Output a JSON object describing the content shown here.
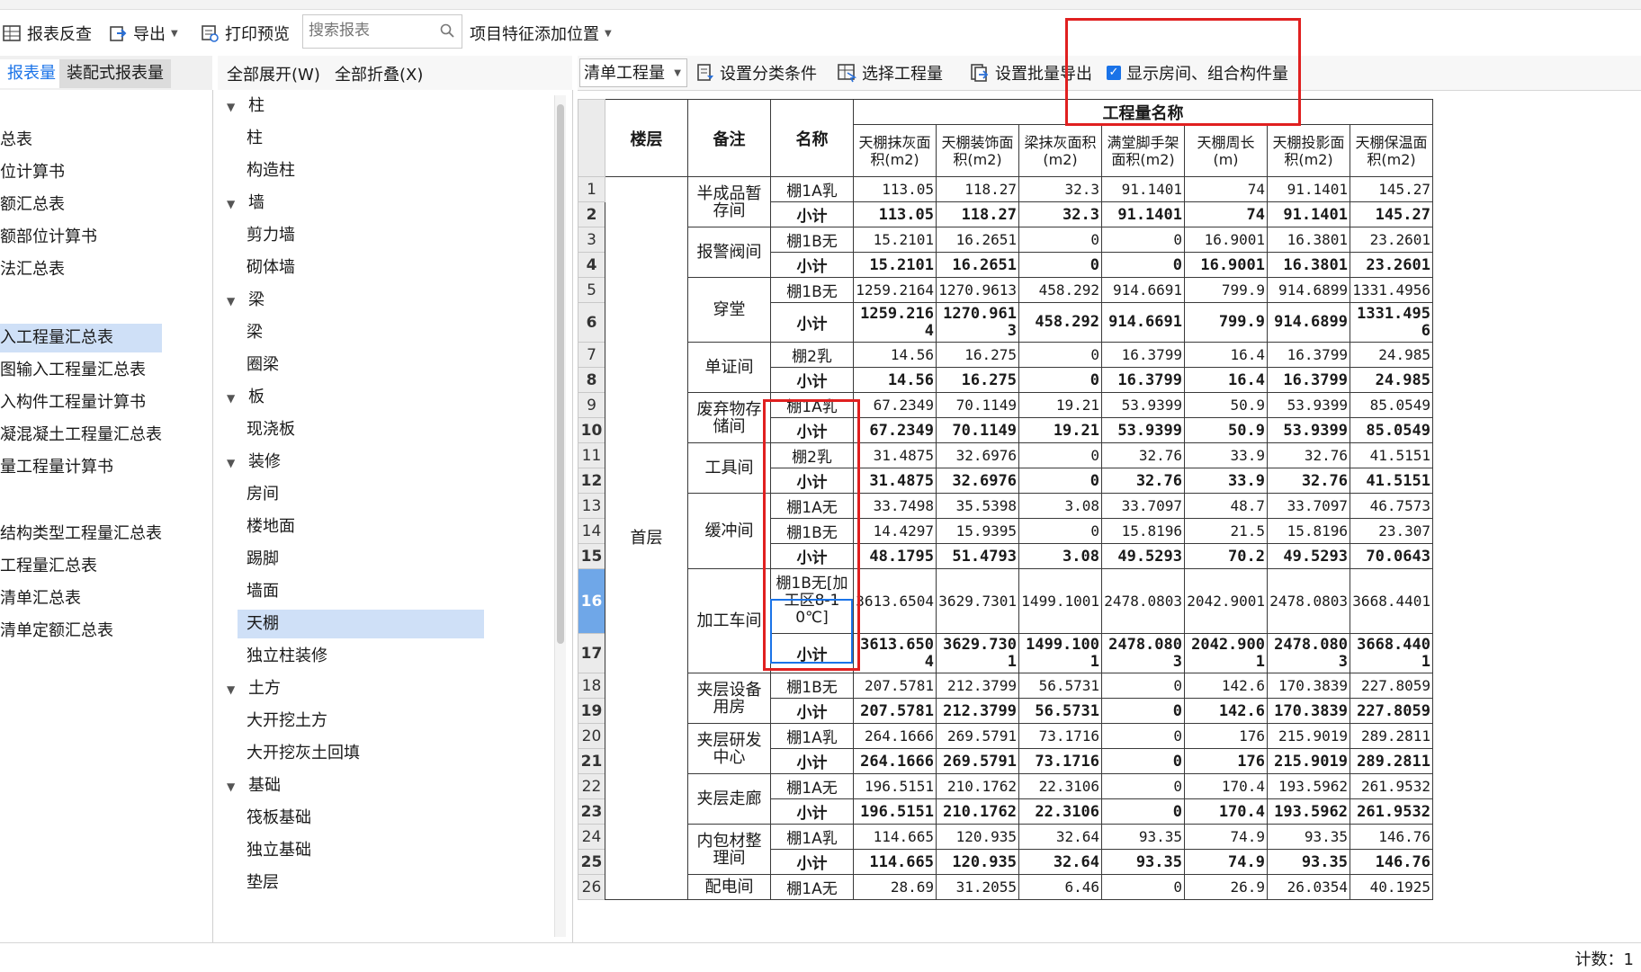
{
  "toolbar": {
    "report_check": "报表反查",
    "export": "导出",
    "print_preview": "打印预览",
    "search_placeholder": "搜索报表",
    "feature_position": "项目特征添加位置"
  },
  "left_tabs": {
    "tab1": "报表量",
    "tab2": "装配式报表量"
  },
  "left_list": [
    "总表",
    "位计算书",
    "额汇总表",
    "额部位计算书",
    "法汇总表",
    "入工程量汇总表",
    "图输入工程量汇总表",
    "入构件工程量计算书",
    "凝混凝土工程量汇总表",
    "量工程量计算书",
    "结构类型工程量汇总表",
    "工程量汇总表",
    "清单汇总表",
    "清单定额汇总表"
  ],
  "tree_tools": {
    "expand_all": "全部展开(W)",
    "collapse_all": "全部折叠(X)"
  },
  "tree": [
    {
      "label": "柱",
      "group": true
    },
    {
      "label": "柱"
    },
    {
      "label": "构造柱"
    },
    {
      "label": "墙",
      "group": true
    },
    {
      "label": "剪力墙"
    },
    {
      "label": "砌体墙"
    },
    {
      "label": "梁",
      "group": true
    },
    {
      "label": "梁"
    },
    {
      "label": "圈梁"
    },
    {
      "label": "板",
      "group": true
    },
    {
      "label": "现浇板"
    },
    {
      "label": "装修",
      "group": true
    },
    {
      "label": "房间"
    },
    {
      "label": "楼地面"
    },
    {
      "label": "踢脚"
    },
    {
      "label": "墙面"
    },
    {
      "label": "天棚",
      "selected": true
    },
    {
      "label": "独立柱装修"
    },
    {
      "label": "土方",
      "group": true
    },
    {
      "label": "大开挖土方"
    },
    {
      "label": "大开挖灰土回填"
    },
    {
      "label": "基础",
      "group": true
    },
    {
      "label": "筏板基础"
    },
    {
      "label": "独立基础"
    },
    {
      "label": "垫层"
    }
  ],
  "grid_tools": {
    "qty_select": "清单工程量",
    "set_category": "设置分类条件",
    "select_qty": "选择工程量",
    "batch_export": "设置批量导出",
    "show_room": "显示房间、组合构件量"
  },
  "table": {
    "h_floor": "楼层",
    "h_note": "备注",
    "h_name": "名称",
    "h_group": "工程量名称",
    "cols": [
      "天棚抹灰面积(m2)",
      "天棚装饰面积(m2)",
      "梁抹灰面积(m2)",
      "满堂脚手架面积(m2)",
      "天棚周长(m)",
      "天棚投影面积(m2)",
      "天棚保温面积(m2)"
    ],
    "floor": "首层",
    "groups": [
      {
        "note": "半成品暂存间",
        "rows": [
          {
            "n": "1",
            "name": "棚1A乳",
            "v": [
              "113.05",
              "118.27",
              "32.3",
              "91.1401",
              "74",
              "91.1401",
              "145.27"
            ]
          },
          {
            "n": "2",
            "name": "小计",
            "sub": true,
            "v": [
              "113.05",
              "118.27",
              "32.3",
              "91.1401",
              "74",
              "91.1401",
              "145.27"
            ]
          }
        ]
      },
      {
        "note": "报警阀间",
        "rows": [
          {
            "n": "3",
            "name": "棚1B无",
            "v": [
              "15.2101",
              "16.2651",
              "0",
              "0",
              "16.9001",
              "16.3801",
              "23.2601"
            ]
          },
          {
            "n": "4",
            "name": "小计",
            "sub": true,
            "v": [
              "15.2101",
              "16.2651",
              "0",
              "0",
              "16.9001",
              "16.3801",
              "23.2601"
            ]
          }
        ]
      },
      {
        "note": "穿堂",
        "rows": [
          {
            "n": "5",
            "name": "棚1B无",
            "v": [
              "1259.2164",
              "1270.9613",
              "458.292",
              "914.6691",
              "799.9",
              "914.6899",
              "1331.4956"
            ]
          },
          {
            "n": "6",
            "name": "小计",
            "sub": true,
            "tall": true,
            "v": [
              "1259.2164",
              "1270.9613",
              "458.292",
              "914.6691",
              "799.9",
              "914.6899",
              "1331.4956"
            ]
          }
        ]
      },
      {
        "note": "单证间",
        "rows": [
          {
            "n": "7",
            "name": "棚2乳",
            "v": [
              "14.56",
              "16.275",
              "0",
              "16.3799",
              "16.4",
              "16.3799",
              "24.985"
            ]
          },
          {
            "n": "8",
            "name": "小计",
            "sub": true,
            "v": [
              "14.56",
              "16.275",
              "0",
              "16.3799",
              "16.4",
              "16.3799",
              "24.985"
            ]
          }
        ]
      },
      {
        "note": "废弃物存储间",
        "rows": [
          {
            "n": "9",
            "name": "棚1A乳",
            "v": [
              "67.2349",
              "70.1149",
              "19.21",
              "53.9399",
              "50.9",
              "53.9399",
              "85.0549"
            ]
          },
          {
            "n": "10",
            "name": "小计",
            "sub": true,
            "v": [
              "67.2349",
              "70.1149",
              "19.21",
              "53.9399",
              "50.9",
              "53.9399",
              "85.0549"
            ]
          }
        ]
      },
      {
        "note": "工具间",
        "rows": [
          {
            "n": "11",
            "name": "棚2乳",
            "v": [
              "31.4875",
              "32.6976",
              "0",
              "32.76",
              "33.9",
              "32.76",
              "41.5151"
            ]
          },
          {
            "n": "12",
            "name": "小计",
            "sub": true,
            "v": [
              "31.4875",
              "32.6976",
              "0",
              "32.76",
              "33.9",
              "32.76",
              "41.5151"
            ]
          }
        ]
      },
      {
        "note": "缓冲间",
        "rows": [
          {
            "n": "13",
            "name": "棚1A无",
            "v": [
              "33.7498",
              "35.5398",
              "3.08",
              "33.7097",
              "48.7",
              "33.7097",
              "46.7573"
            ]
          },
          {
            "n": "14",
            "name": "棚1B无",
            "v": [
              "14.4297",
              "15.9395",
              "0",
              "15.8196",
              "21.5",
              "15.8196",
              "23.307"
            ]
          },
          {
            "n": "15",
            "name": "小计",
            "sub": true,
            "v": [
              "48.1795",
              "51.4793",
              "3.08",
              "49.5293",
              "70.2",
              "49.5293",
              "70.0643"
            ]
          }
        ]
      },
      {
        "note": "加工车间",
        "rows": [
          {
            "n": "16",
            "name": "棚1B无[加工区8-10℃]",
            "tall2": true,
            "v": [
              "3613.6504",
              "3629.7301",
              "1499.1001",
              "2478.0803",
              "2042.9001",
              "2478.0803",
              "3668.4401"
            ]
          },
          {
            "n": "17",
            "name": "小计",
            "sub": true,
            "tall": true,
            "v": [
              "3613.6504",
              "3629.7301",
              "1499.1001",
              "2478.0803",
              "2042.9001",
              "2478.0803",
              "3668.4401"
            ]
          }
        ]
      },
      {
        "note": "夹层设备用房",
        "rows": [
          {
            "n": "18",
            "name": "棚1B无",
            "v": [
              "207.5781",
              "212.3799",
              "56.5731",
              "0",
              "142.6",
              "170.3839",
              "227.8059"
            ]
          },
          {
            "n": "19",
            "name": "小计",
            "sub": true,
            "v": [
              "207.5781",
              "212.3799",
              "56.5731",
              "0",
              "142.6",
              "170.3839",
              "227.8059"
            ]
          }
        ]
      },
      {
        "note": "夹层研发中心",
        "rows": [
          {
            "n": "20",
            "name": "棚1A乳",
            "v": [
              "264.1666",
              "269.5791",
              "73.1716",
              "0",
              "176",
              "215.9019",
              "289.2811"
            ]
          },
          {
            "n": "21",
            "name": "小计",
            "sub": true,
            "v": [
              "264.1666",
              "269.5791",
              "73.1716",
              "0",
              "176",
              "215.9019",
              "289.2811"
            ]
          }
        ]
      },
      {
        "note": "夹层走廊",
        "rows": [
          {
            "n": "22",
            "name": "棚1A无",
            "v": [
              "196.5151",
              "210.1762",
              "22.3106",
              "0",
              "170.4",
              "193.5962",
              "261.9532"
            ]
          },
          {
            "n": "23",
            "name": "小计",
            "sub": true,
            "v": [
              "196.5151",
              "210.1762",
              "22.3106",
              "0",
              "170.4",
              "193.5962",
              "261.9532"
            ]
          }
        ]
      },
      {
        "note": "内包材整理间",
        "rows": [
          {
            "n": "24",
            "name": "棚1A乳",
            "v": [
              "114.665",
              "120.935",
              "32.64",
              "93.35",
              "74.9",
              "93.35",
              "146.76"
            ]
          },
          {
            "n": "25",
            "name": "小计",
            "sub": true,
            "v": [
              "114.665",
              "120.935",
              "32.64",
              "93.35",
              "74.9",
              "93.35",
              "146.76"
            ]
          }
        ]
      },
      {
        "note": "配电间",
        "rows": [
          {
            "n": "26",
            "name": "棚1A无",
            "v": [
              "28.69",
              "31.2055",
              "6.46",
              "0",
              "26.9",
              "26.0354",
              "40.1925"
            ]
          }
        ]
      }
    ]
  },
  "status": {
    "count": "计数：1"
  },
  "colors": {
    "highlight": "#e02020",
    "selection": "#cfe0f7",
    "accent": "#1a73e8"
  }
}
